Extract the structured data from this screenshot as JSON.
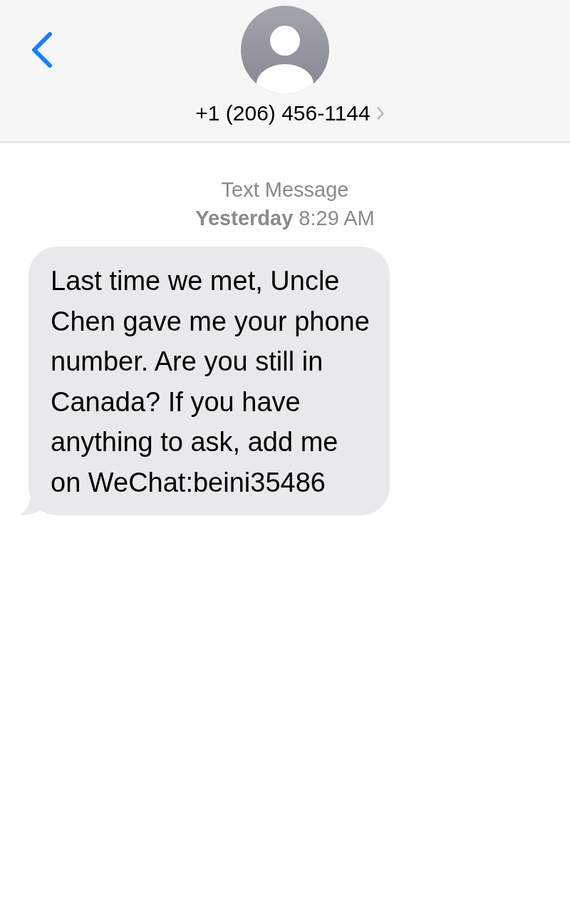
{
  "header": {
    "contact": "+1 (206) 456-1144"
  },
  "conversation": {
    "service": "Text Message",
    "timestamp": "**Yesterday** 8:29 AM",
    "messages": [
      {
        "kind": "incoming",
        "text": "Last time we met, Uncle Chen gave me your phone number. Are you still in Canada? If you have anything to ask, add me on WeChat:beini35486"
      }
    ]
  }
}
